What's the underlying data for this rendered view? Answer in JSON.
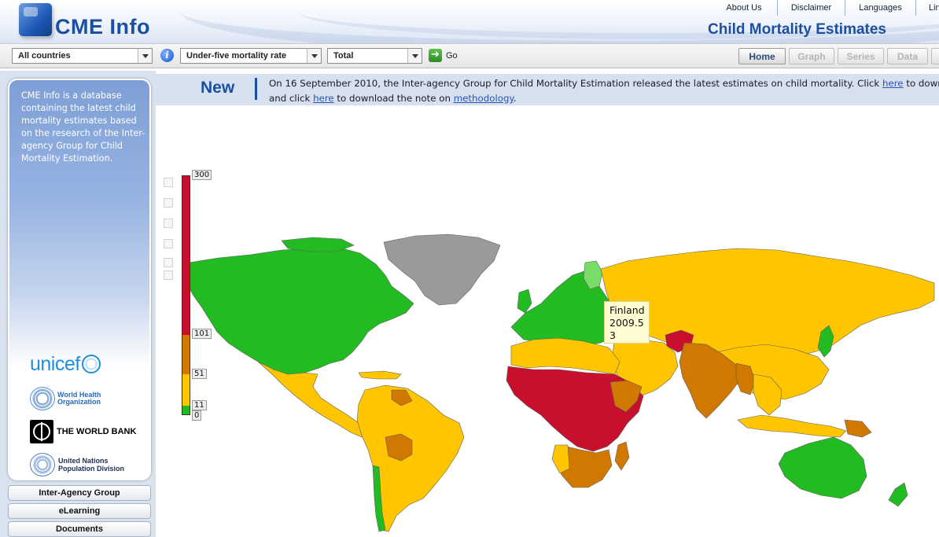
{
  "header": {
    "logo_text": "CME Info",
    "app_title": "Child Mortality Estimates",
    "top_links": [
      "About Us",
      "Disclaimer",
      "Languages",
      "Lin"
    ]
  },
  "toolbar": {
    "area_select": "All countries",
    "indicator_select": "Under-five mortality rate",
    "sex_select": "Total",
    "go_label": "Go",
    "tabs": [
      {
        "label": "Home",
        "active": true
      },
      {
        "label": "Graph",
        "active": false
      },
      {
        "label": "Series",
        "active": false
      },
      {
        "label": "Data",
        "active": false
      }
    ]
  },
  "sidebar": {
    "description": "CME Info is a database containing the latest child mortality estimates based on the research of the Inter-agency Group for Child Mortality Estimation.",
    "partners": {
      "unicef": "unicef",
      "who_line1": "World Health",
      "who_line2": "Organization",
      "worldbank": "THE WORLD BANK",
      "un_line1": "United Nations",
      "un_line2": "Population Division"
    },
    "nav": [
      "Inter-Agency Group",
      "eLearning",
      "Documents"
    ]
  },
  "news": {
    "title": "New",
    "line1_prefix": "On 16 September 2010, the Inter-agency Group for Child Mortality Estimation released the latest estimates on child mortality. Click ",
    "link1": "here",
    "line1_suffix": " to download",
    "line2_prefix": "and click ",
    "link2": "here",
    "line2_mid": " to download the note on ",
    "link3": "methodology",
    "line2_suffix": "."
  },
  "map": {
    "legend": {
      "labels": [
        "300",
        "101",
        "51",
        "11",
        "0"
      ],
      "colors": {
        "very_high": "#c8102e",
        "high": "#d07800",
        "medium": "#ffc600",
        "low": "#22bb22",
        "no_data": "#9a9a9a"
      }
    },
    "tooltip": {
      "country": "Finland",
      "value_line1": "2009.5",
      "value_line2": "3"
    }
  }
}
